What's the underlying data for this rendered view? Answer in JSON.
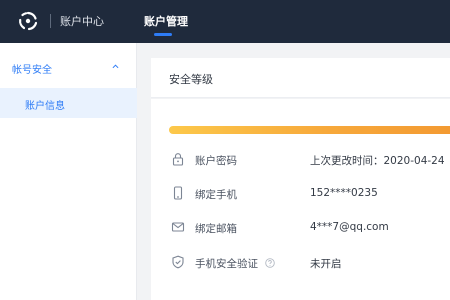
{
  "header": {
    "app_title": "账户中心",
    "nav_active": "账户管理",
    "logo_icon": "pinwheel-logo-icon",
    "background": "#1f2a3c",
    "accent": "#2e7cf6"
  },
  "sidebar": {
    "group_label": "帐号安全",
    "group_icon": "chevron-up-icon",
    "items": [
      {
        "label": "账户信息",
        "active": true
      }
    ]
  },
  "card": {
    "title": "安全等级",
    "security_level_progress": 1.0,
    "progress_colors": [
      "#fcc84a",
      "#f39a32"
    ],
    "rows": [
      {
        "icon": "lock-icon",
        "label": "账户密码",
        "value": "上次更改时间：2020-04-24"
      },
      {
        "icon": "phone-icon",
        "label": "绑定手机",
        "value": "152****0235"
      },
      {
        "icon": "mail-icon",
        "label": "绑定邮箱",
        "value": "4***7@qq.com"
      },
      {
        "icon": "shield-icon",
        "label": "手机安全验证",
        "value": "未开启",
        "help_icon": "question-circle-icon"
      }
    ]
  }
}
